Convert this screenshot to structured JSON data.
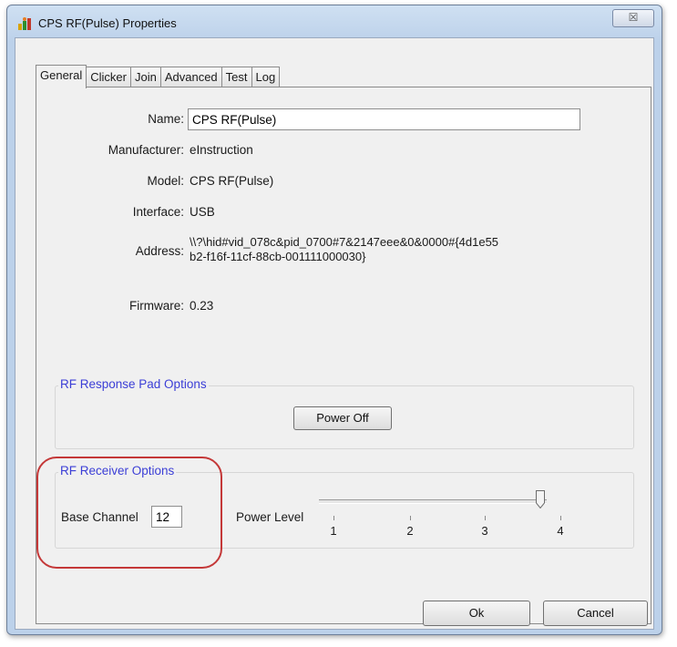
{
  "window": {
    "title": "CPS RF(Pulse) Properties",
    "close_glyph": "☒"
  },
  "tabs": [
    {
      "label": "General",
      "active": true
    },
    {
      "label": "Clicker",
      "active": false
    },
    {
      "label": "Join",
      "active": false
    },
    {
      "label": "Advanced",
      "active": false
    },
    {
      "label": "Test",
      "active": false
    },
    {
      "label": "Log",
      "active": false
    }
  ],
  "general": {
    "name_label": "Name:",
    "name_value": "CPS RF(Pulse)",
    "manufacturer_label": "Manufacturer:",
    "manufacturer_value": "eInstruction",
    "model_label": "Model:",
    "model_value": "CPS RF(Pulse)",
    "interface_label": "Interface:",
    "interface_value": "USB",
    "address_label": "Address:",
    "address_line1": "\\\\?\\hid#vid_078c&pid_0700#7&2147eee&0&0000#{4d1e55",
    "address_line2": "b2-f16f-11cf-88cb-001111000030}",
    "firmware_label": "Firmware:",
    "firmware_value": "0.23"
  },
  "response_pad": {
    "title": "RF Response Pad Options",
    "power_off_label": "Power Off"
  },
  "receiver": {
    "title": "RF Receiver Options",
    "base_channel_label": "Base Channel",
    "base_channel_value": "12",
    "power_level_label": "Power Level",
    "power_level_ticks": [
      "1",
      "2",
      "3",
      "4"
    ],
    "power_level_value": 4
  },
  "footer": {
    "ok_label": "Ok",
    "cancel_label": "Cancel"
  },
  "colors": {
    "group_title": "#3b3ed6",
    "highlight_outline": "#c43838"
  }
}
